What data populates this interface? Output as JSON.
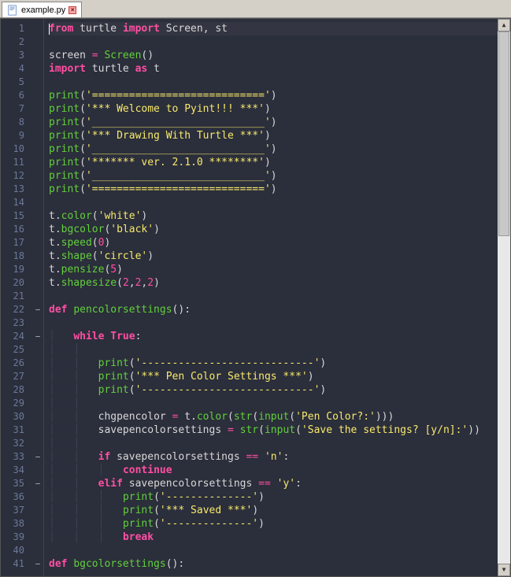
{
  "tab": {
    "filename": "example.py"
  },
  "lines": [
    {
      "n": 1,
      "fold": "",
      "tokens": [
        [
          "kw",
          "from"
        ],
        [
          "punc",
          " "
        ],
        [
          "ident",
          "turtle"
        ],
        [
          "punc",
          " "
        ],
        [
          "kw",
          "import"
        ],
        [
          "punc",
          " "
        ],
        [
          "ident",
          "Screen"
        ],
        [
          "punc",
          ", "
        ],
        [
          "ident",
          "st"
        ]
      ],
      "cursor": true
    },
    {
      "n": 2,
      "fold": "",
      "tokens": []
    },
    {
      "n": 3,
      "fold": "",
      "tokens": [
        [
          "ident",
          "screen"
        ],
        [
          "punc",
          " "
        ],
        [
          "op",
          "="
        ],
        [
          "punc",
          " "
        ],
        [
          "call",
          "Screen"
        ],
        [
          "punc",
          "()"
        ]
      ]
    },
    {
      "n": 4,
      "fold": "",
      "tokens": [
        [
          "kw",
          "import"
        ],
        [
          "punc",
          " "
        ],
        [
          "ident",
          "turtle"
        ],
        [
          "punc",
          " "
        ],
        [
          "kw",
          "as"
        ],
        [
          "punc",
          " "
        ],
        [
          "ident",
          "t"
        ]
      ]
    },
    {
      "n": 5,
      "fold": "",
      "tokens": []
    },
    {
      "n": 6,
      "fold": "",
      "tokens": [
        [
          "call",
          "print"
        ],
        [
          "punc",
          "("
        ],
        [
          "str",
          "'============================'"
        ],
        [
          "punc",
          ")"
        ]
      ]
    },
    {
      "n": 7,
      "fold": "",
      "tokens": [
        [
          "call",
          "print"
        ],
        [
          "punc",
          "("
        ],
        [
          "str",
          "'*** Welcome to Pyint!!! ***'"
        ],
        [
          "punc",
          ")"
        ]
      ]
    },
    {
      "n": 8,
      "fold": "",
      "tokens": [
        [
          "call",
          "print"
        ],
        [
          "punc",
          "("
        ],
        [
          "str",
          "'____________________________'"
        ],
        [
          "punc",
          ")"
        ]
      ]
    },
    {
      "n": 9,
      "fold": "",
      "tokens": [
        [
          "call",
          "print"
        ],
        [
          "punc",
          "("
        ],
        [
          "str",
          "'*** Drawing With Turtle ***'"
        ],
        [
          "punc",
          ")"
        ]
      ]
    },
    {
      "n": 10,
      "fold": "",
      "tokens": [
        [
          "call",
          "print"
        ],
        [
          "punc",
          "("
        ],
        [
          "str",
          "'____________________________'"
        ],
        [
          "punc",
          ")"
        ]
      ]
    },
    {
      "n": 11,
      "fold": "",
      "tokens": [
        [
          "call",
          "print"
        ],
        [
          "punc",
          "("
        ],
        [
          "str",
          "'******* ver. 2.1.0 ********'"
        ],
        [
          "punc",
          ")"
        ]
      ]
    },
    {
      "n": 12,
      "fold": "",
      "tokens": [
        [
          "call",
          "print"
        ],
        [
          "punc",
          "("
        ],
        [
          "str",
          "'____________________________'"
        ],
        [
          "punc",
          ")"
        ]
      ]
    },
    {
      "n": 13,
      "fold": "",
      "tokens": [
        [
          "call",
          "print"
        ],
        [
          "punc",
          "("
        ],
        [
          "str",
          "'============================'"
        ],
        [
          "punc",
          ")"
        ]
      ]
    },
    {
      "n": 14,
      "fold": "",
      "tokens": []
    },
    {
      "n": 15,
      "fold": "",
      "tokens": [
        [
          "ident",
          "t"
        ],
        [
          "punc",
          "."
        ],
        [
          "attr",
          "color"
        ],
        [
          "punc",
          "("
        ],
        [
          "str",
          "'white'"
        ],
        [
          "punc",
          ")"
        ]
      ]
    },
    {
      "n": 16,
      "fold": "",
      "tokens": [
        [
          "ident",
          "t"
        ],
        [
          "punc",
          "."
        ],
        [
          "attr",
          "bgcolor"
        ],
        [
          "punc",
          "("
        ],
        [
          "str",
          "'black'"
        ],
        [
          "punc",
          ")"
        ]
      ]
    },
    {
      "n": 17,
      "fold": "",
      "tokens": [
        [
          "ident",
          "t"
        ],
        [
          "punc",
          "."
        ],
        [
          "attr",
          "speed"
        ],
        [
          "punc",
          "("
        ],
        [
          "num",
          "0"
        ],
        [
          "punc",
          ")"
        ]
      ]
    },
    {
      "n": 18,
      "fold": "",
      "tokens": [
        [
          "ident",
          "t"
        ],
        [
          "punc",
          "."
        ],
        [
          "attr",
          "shape"
        ],
        [
          "punc",
          "("
        ],
        [
          "str",
          "'circle'"
        ],
        [
          "punc",
          ")"
        ]
      ]
    },
    {
      "n": 19,
      "fold": "",
      "tokens": [
        [
          "ident",
          "t"
        ],
        [
          "punc",
          "."
        ],
        [
          "attr",
          "pensize"
        ],
        [
          "punc",
          "("
        ],
        [
          "num",
          "5"
        ],
        [
          "punc",
          ")"
        ]
      ]
    },
    {
      "n": 20,
      "fold": "",
      "tokens": [
        [
          "ident",
          "t"
        ],
        [
          "punc",
          "."
        ],
        [
          "attr",
          "shapesize"
        ],
        [
          "punc",
          "("
        ],
        [
          "num",
          "2"
        ],
        [
          "punc",
          ","
        ],
        [
          "num",
          "2"
        ],
        [
          "punc",
          ","
        ],
        [
          "num",
          "2"
        ],
        [
          "punc",
          ")"
        ]
      ]
    },
    {
      "n": 21,
      "fold": "",
      "tokens": []
    },
    {
      "n": 22,
      "fold": "-",
      "tokens": [
        [
          "kw",
          "def"
        ],
        [
          "punc",
          " "
        ],
        [
          "funcdef",
          "pencolorsettings"
        ],
        [
          "punc",
          "():"
        ]
      ]
    },
    {
      "n": 23,
      "fold": "",
      "tokens": []
    },
    {
      "n": 24,
      "fold": "-",
      "tokens": [
        [
          "guide",
          "    "
        ],
        [
          "kw",
          "while"
        ],
        [
          "punc",
          " "
        ],
        [
          "bool",
          "True"
        ],
        [
          "punc",
          ":"
        ]
      ]
    },
    {
      "n": 25,
      "fold": "",
      "tokens": [
        [
          "guide",
          "    "
        ],
        [
          "guide",
          "    "
        ]
      ]
    },
    {
      "n": 26,
      "fold": "",
      "tokens": [
        [
          "guide",
          "    "
        ],
        [
          "guide",
          "    "
        ],
        [
          "call",
          "print"
        ],
        [
          "punc",
          "("
        ],
        [
          "str",
          "'----------------------------'"
        ],
        [
          "punc",
          ")"
        ]
      ]
    },
    {
      "n": 27,
      "fold": "",
      "tokens": [
        [
          "guide",
          "    "
        ],
        [
          "guide",
          "    "
        ],
        [
          "call",
          "print"
        ],
        [
          "punc",
          "("
        ],
        [
          "str",
          "'*** Pen Color Settings ***'"
        ],
        [
          "punc",
          ")"
        ]
      ]
    },
    {
      "n": 28,
      "fold": "",
      "tokens": [
        [
          "guide",
          "    "
        ],
        [
          "guide",
          "    "
        ],
        [
          "call",
          "print"
        ],
        [
          "punc",
          "("
        ],
        [
          "str",
          "'----------------------------'"
        ],
        [
          "punc",
          ")"
        ]
      ]
    },
    {
      "n": 29,
      "fold": "",
      "tokens": [
        [
          "guide",
          "    "
        ],
        [
          "guide",
          "    "
        ]
      ]
    },
    {
      "n": 30,
      "fold": "",
      "tokens": [
        [
          "guide",
          "    "
        ],
        [
          "guide",
          "    "
        ],
        [
          "ident",
          "chgpencolor"
        ],
        [
          "punc",
          " "
        ],
        [
          "op",
          "="
        ],
        [
          "punc",
          " "
        ],
        [
          "ident",
          "t"
        ],
        [
          "punc",
          "."
        ],
        [
          "attr",
          "color"
        ],
        [
          "punc",
          "("
        ],
        [
          "call",
          "str"
        ],
        [
          "punc",
          "("
        ],
        [
          "call",
          "input"
        ],
        [
          "punc",
          "("
        ],
        [
          "str",
          "'Pen Color?:'"
        ],
        [
          "punc",
          ")))"
        ]
      ]
    },
    {
      "n": 31,
      "fold": "",
      "tokens": [
        [
          "guide",
          "    "
        ],
        [
          "guide",
          "    "
        ],
        [
          "ident",
          "savepencolorsettings"
        ],
        [
          "punc",
          " "
        ],
        [
          "op",
          "="
        ],
        [
          "punc",
          " "
        ],
        [
          "call",
          "str"
        ],
        [
          "punc",
          "("
        ],
        [
          "call",
          "input"
        ],
        [
          "punc",
          "("
        ],
        [
          "str",
          "'Save the settings? [y/n]:'"
        ],
        [
          "punc",
          "))"
        ]
      ]
    },
    {
      "n": 32,
      "fold": "",
      "tokens": [
        [
          "guide",
          "    "
        ],
        [
          "guide",
          "    "
        ]
      ]
    },
    {
      "n": 33,
      "fold": "-",
      "tokens": [
        [
          "guide",
          "    "
        ],
        [
          "guide",
          "    "
        ],
        [
          "kw",
          "if"
        ],
        [
          "punc",
          " "
        ],
        [
          "ident",
          "savepencolorsettings"
        ],
        [
          "punc",
          " "
        ],
        [
          "op",
          "=="
        ],
        [
          "punc",
          " "
        ],
        [
          "str",
          "'n'"
        ],
        [
          "punc",
          ":"
        ]
      ]
    },
    {
      "n": 34,
      "fold": "",
      "tokens": [
        [
          "guide",
          "    "
        ],
        [
          "guide",
          "    "
        ],
        [
          "guide",
          "    "
        ],
        [
          "kw",
          "continue"
        ]
      ]
    },
    {
      "n": 35,
      "fold": "-",
      "tokens": [
        [
          "guide",
          "    "
        ],
        [
          "guide",
          "    "
        ],
        [
          "kw",
          "elif"
        ],
        [
          "punc",
          " "
        ],
        [
          "ident",
          "savepencolorsettings"
        ],
        [
          "punc",
          " "
        ],
        [
          "op",
          "=="
        ],
        [
          "punc",
          " "
        ],
        [
          "str",
          "'y'"
        ],
        [
          "punc",
          ":"
        ]
      ]
    },
    {
      "n": 36,
      "fold": "",
      "tokens": [
        [
          "guide",
          "    "
        ],
        [
          "guide",
          "    "
        ],
        [
          "guide",
          "    "
        ],
        [
          "call",
          "print"
        ],
        [
          "punc",
          "("
        ],
        [
          "str",
          "'--------------'"
        ],
        [
          "punc",
          ")"
        ]
      ]
    },
    {
      "n": 37,
      "fold": "",
      "tokens": [
        [
          "guide",
          "    "
        ],
        [
          "guide",
          "    "
        ],
        [
          "guide",
          "    "
        ],
        [
          "call",
          "print"
        ],
        [
          "punc",
          "("
        ],
        [
          "str",
          "'*** Saved ***'"
        ],
        [
          "punc",
          ")"
        ]
      ]
    },
    {
      "n": 38,
      "fold": "",
      "tokens": [
        [
          "guide",
          "    "
        ],
        [
          "guide",
          "    "
        ],
        [
          "guide",
          "    "
        ],
        [
          "call",
          "print"
        ],
        [
          "punc",
          "("
        ],
        [
          "str",
          "'--------------'"
        ],
        [
          "punc",
          ")"
        ]
      ]
    },
    {
      "n": 39,
      "fold": "",
      "tokens": [
        [
          "guide",
          "    "
        ],
        [
          "guide",
          "    "
        ],
        [
          "guide",
          "    "
        ],
        [
          "kw",
          "break"
        ]
      ]
    },
    {
      "n": 40,
      "fold": "",
      "tokens": []
    },
    {
      "n": 41,
      "fold": "-",
      "tokens": [
        [
          "kw",
          "def"
        ],
        [
          "punc",
          " "
        ],
        [
          "funcdef",
          "bgcolorsettings"
        ],
        [
          "punc",
          "():"
        ]
      ]
    }
  ]
}
